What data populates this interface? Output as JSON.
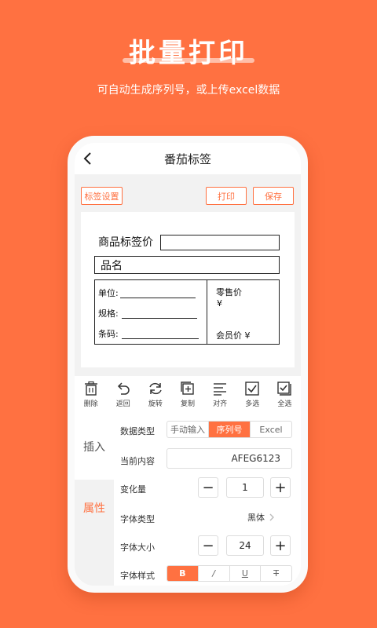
{
  "hero": {
    "title": "批量打印",
    "subtitle": "可自动生成序列号，或上传excel数据"
  },
  "navbar": {
    "title": "番茄标签"
  },
  "actions": {
    "label_settings": "标签设置",
    "print": "打印",
    "save": "保存"
  },
  "label_canvas": {
    "product_price_label": "商品标签价",
    "product_name_label": "品名",
    "unit_label": "单位:",
    "spec_label": "规格:",
    "barcode_label": "条码:",
    "retail_price_label": "零售价",
    "retail_currency": "¥",
    "member_price_label": "会员价 ¥"
  },
  "toolbar": {
    "items": [
      {
        "label": "删除",
        "icon": "trash-icon"
      },
      {
        "label": "返回",
        "icon": "undo-icon"
      },
      {
        "label": "旋转",
        "icon": "rotate-icon"
      },
      {
        "label": "复制",
        "icon": "copy-icon"
      },
      {
        "label": "对齐",
        "icon": "align-icon"
      },
      {
        "label": "多选",
        "icon": "checkbox-icon"
      },
      {
        "label": "全选",
        "icon": "select-all-icon"
      }
    ]
  },
  "side_tabs": {
    "insert": "插入",
    "properties": "属性"
  },
  "properties": {
    "data_type_label": "数据类型",
    "data_type_options": [
      "手动输入",
      "序列号",
      "Excel"
    ],
    "data_type_selected": "序列号",
    "current_content_label": "当前内容",
    "current_content_value": "AFEG6123",
    "increment_label": "变化量",
    "increment_value": "1",
    "font_type_label": "字体类型",
    "font_type_value": "黑体",
    "font_size_label": "字体大小",
    "font_size_value": "24",
    "font_style_label": "字体样式",
    "font_style_options": [
      "B",
      "/",
      "U",
      "T"
    ],
    "font_style_selected": "B",
    "minus": "−",
    "plus": "+"
  },
  "colors": {
    "accent": "#ff7141",
    "background": "#ff7141"
  }
}
